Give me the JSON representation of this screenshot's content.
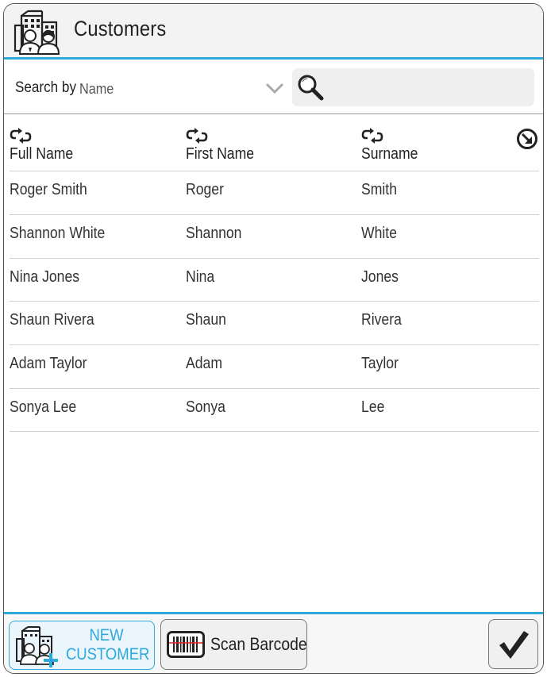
{
  "header": {
    "title": "Customers",
    "icon": "customers-building-icon"
  },
  "search": {
    "label": "Search by",
    "field_value": "Name",
    "placeholder": ""
  },
  "table": {
    "columns": [
      "Full Name",
      "First Name",
      "Surname"
    ],
    "rows": [
      [
        "Roger Smith",
        "Roger",
        "Smith"
      ],
      [
        "Shannon White",
        "Shannon",
        "White"
      ],
      [
        "Nina Jones",
        "Nina",
        "Jones"
      ],
      [
        "Shaun Rivera",
        "Shaun",
        "Rivera"
      ],
      [
        "Adam Taylor",
        "Adam",
        "Taylor"
      ],
      [
        "Sonya Lee",
        "Sonya",
        "Lee"
      ]
    ]
  },
  "footer": {
    "new_customer_line1": "NEW",
    "new_customer_line2": "CUSTOMER",
    "scan_barcode": "Scan Barcode"
  },
  "colors": {
    "accent": "#2fa8dc",
    "text": "#222222"
  }
}
